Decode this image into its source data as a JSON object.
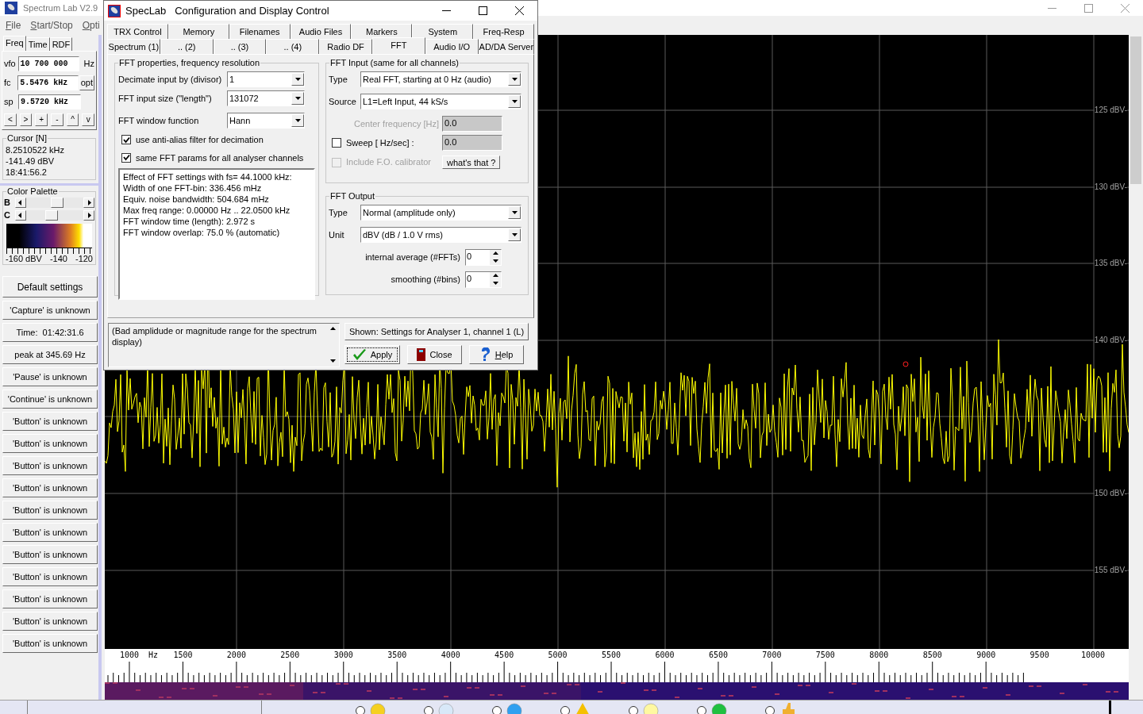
{
  "main_window": {
    "title": "Spectrum Lab V2.9",
    "menu": [
      "File",
      "Start/Stop",
      "Opti"
    ]
  },
  "left_panel": {
    "tabs": [
      {
        "label": "Freq",
        "selected": true
      },
      {
        "label": "Time",
        "selected": false
      },
      {
        "label": "RDF",
        "selected": false
      }
    ],
    "fields": [
      {
        "label": "vfo",
        "value": "10 700 000",
        "unit": "Hz"
      },
      {
        "label": "fc",
        "value": "5.5476 kHz",
        "button": "opt"
      },
      {
        "label": "sp",
        "value": "9.5720 kHz"
      }
    ],
    "step_buttons": [
      "<",
      ">",
      "+",
      "-",
      "^",
      "v"
    ],
    "cursor": {
      "title": "Cursor [N]",
      "lines": [
        "8.2510522 kHz",
        "-141.49 dBV",
        "18:41:56.2"
      ]
    },
    "palette": {
      "title": "Color Palette",
      "sliders": [
        {
          "label": "B",
          "level": 0.55
        },
        {
          "label": "C",
          "level": 0.45
        }
      ],
      "scale": [
        "-160 dBV",
        "-140",
        "-120"
      ]
    },
    "buttons": [
      "Default settings",
      "'Capture' is unknown",
      "Time:  01:42:31.6",
      "peak at 345.69 Hz",
      "'Pause' is unknown",
      "'Continue' is unknown",
      "'Button' is unknown",
      "'Button' is unknown",
      "'Button' is unknown",
      "'Button' is unknown",
      "'Button' is unknown",
      "'Button' is unknown",
      "'Button' is unknown",
      "'Button' is unknown",
      "'Button' is unknown",
      "'Button' is unknown",
      "'Button' is unknown"
    ]
  },
  "plot": {
    "y_labels": [
      "125 dBV-",
      "130 dBV-",
      "135 dBV-",
      "140 dBV-",
      "150 dBV-",
      "155 dBV-"
    ],
    "x_labels": [
      "1000  Hz",
      "1500",
      "2000",
      "2500",
      "3000",
      "3500",
      "4000",
      "4500",
      "5000",
      "5500",
      "6000",
      "6500",
      "7000",
      "7500",
      "8000",
      "8500",
      "9000",
      "9500",
      "10000"
    ]
  },
  "dialog": {
    "title": "SpecLab   Configuration and Display Control",
    "tab_rows": [
      [
        {
          "label": "TRX Control",
          "selected": false
        },
        {
          "label": "Memory",
          "selected": false
        },
        {
          "label": "Filenames",
          "selected": false
        },
        {
          "label": "Audio Files",
          "selected": false
        },
        {
          "label": "Markers",
          "selected": false
        },
        {
          "label": "System",
          "selected": false
        },
        {
          "label": "Freq-Resp",
          "selected": false
        }
      ],
      [
        {
          "label": "Spectrum (1)",
          "selected": false
        },
        {
          "label": ".. (2)",
          "selected": false
        },
        {
          "label": ".. (3)",
          "selected": false
        },
        {
          "label": ".. (4)",
          "selected": false
        },
        {
          "label": "Radio DF",
          "selected": false
        },
        {
          "label": "FFT",
          "selected": true
        },
        {
          "label": "Audio I/O",
          "selected": false
        },
        {
          "label": "AD/DA Server",
          "selected": false
        }
      ]
    ],
    "fft_properties": {
      "title": "FFT properties, frequency resolution",
      "selects": [
        {
          "label": "Decimate input by (divisor)",
          "value": "1"
        },
        {
          "label": "FFT input size (\"length\")",
          "value": "131072"
        },
        {
          "label": "FFT window function",
          "value": "Hann"
        }
      ],
      "checkboxes": [
        {
          "label": "use anti-alias filter for decimation",
          "checked": true
        },
        {
          "label": "same FFT params for all analyser channels",
          "checked": true
        }
      ],
      "info_lines": [
        "Effect of FFT settings with fs= 44.1000 kHz:",
        "Width of one FFT-bin: 336.456 mHz",
        "Equiv. noise bandwidth: 504.684 mHz",
        "Max freq range: 0.00000 Hz .. 22.0500 kHz",
        "FFT window time (length): 2.972 s",
        "FFT window overlap: 75.0 % (automatic)"
      ]
    },
    "fft_input": {
      "title": "FFT Input (same for all channels)",
      "selects": [
        {
          "label": "Type",
          "value": "Real FFT, starting at 0 Hz (audio)"
        },
        {
          "label": "Source",
          "value": "L1=Left Input, 44 kS/s"
        }
      ],
      "center_frequency": {
        "label": "Center frequency [Hz]",
        "value": "0.0",
        "disabled": true
      },
      "sweep": {
        "label": "Sweep [ Hz/sec] :",
        "checked": false,
        "value": "0.0"
      },
      "calibrator": {
        "label": "Include F.O. calibrator",
        "checked": false,
        "disabled": true
      },
      "help_button": "what's that ?"
    },
    "fft_output": {
      "title": "FFT Output",
      "selects": [
        {
          "label": "Type",
          "value": "Normal (amplitude only)"
        },
        {
          "label": "Unit",
          "value": "dBV  (dB / 1.0 V rms)"
        }
      ],
      "spinners": [
        {
          "label": "internal average (#FFTs)",
          "value": "0"
        },
        {
          "label": "smoothing (#bins)",
          "value": "0"
        }
      ]
    },
    "message": "(Bad amplidude or magnitude range for the spectrum display)",
    "shown": "Shown: Settings for Analyser 1, channel 1 (L)",
    "buttons": [
      {
        "label": "Apply",
        "kind": "apply",
        "focused": true
      },
      {
        "label": "Close",
        "kind": "close",
        "focused": false
      },
      {
        "label": "Help",
        "kind": "help",
        "focused": false
      }
    ]
  },
  "status_bar": {
    "options": [
      {
        "selected": false
      },
      {
        "selected": false
      },
      {
        "selected": false
      },
      {
        "selected": false
      },
      {
        "selected": false
      },
      {
        "selected": false
      },
      {
        "selected": false
      }
    ]
  }
}
